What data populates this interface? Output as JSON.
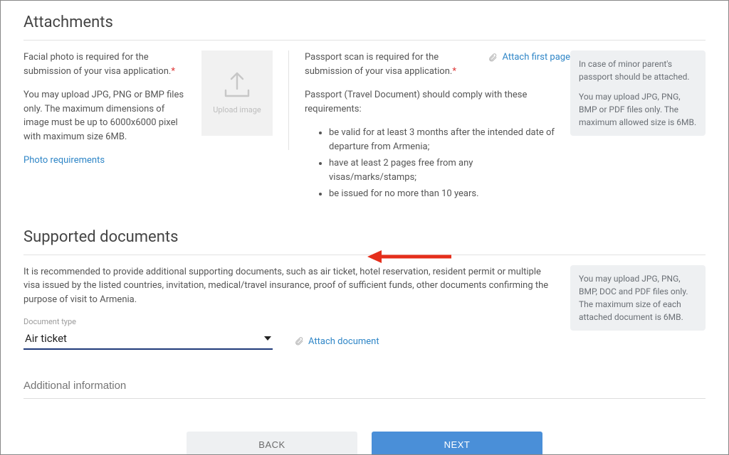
{
  "attachments": {
    "title": "Attachments",
    "photo_text_1": "Facial photo is required for the submission of your visa application.",
    "photo_text_2": "You may upload JPG, PNG or BMP files only. The maximum dimensions of image must be up to 6000x6000 pixel with maximum size 6MB.",
    "photo_requirements_link": "Photo requirements",
    "upload_image_label": "Upload image",
    "passport_text_1": "Passport scan is required for the submission of your visa application.",
    "passport_text_2": "Passport (Travel Document) should comply with these requirements:",
    "passport_reqs": [
      "be valid for at least 3 months after the intended date of departure from Armenia;",
      "have at least 2 pages free from any visas/marks/stamps;",
      "be issued for no more than 10 years."
    ],
    "attach_first_page": "Attach first page",
    "info_box_1": "In case of minor parent's passport should be attached.",
    "info_box_2": "You may upload JPG, PNG, BMP or PDF files only. The maximum allowed size is 6MB."
  },
  "supported": {
    "title": "Supported documents",
    "intro": "It is recommended to provide additional supporting documents, such as air ticket, hotel reservation, resident permit or multiple visa issued by the listed countries, invitation, medical/travel insurance, proof of sufficient funds, other documents confirming the purpose of visit to Armenia.",
    "doctype_label": "Document type",
    "doctype_value": "Air ticket",
    "attach_document": "Attach document",
    "info_box": "You may upload JPG, PNG, BMP, DOC and PDF files only. The maximum size of each attached document is 6MB.",
    "additional_placeholder": "Additional information"
  },
  "buttons": {
    "back": "BACK",
    "next": "NEXT"
  },
  "asterisk": "*"
}
